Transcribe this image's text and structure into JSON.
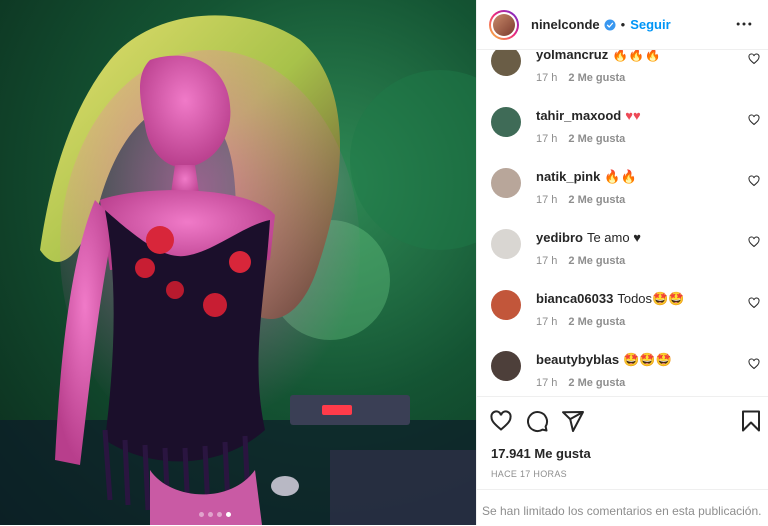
{
  "post": {
    "username": "ninelconde",
    "verified": true,
    "separator": "•",
    "follow_label": "Seguir",
    "likes_text": "17.941 Me gusta",
    "time_ago": "HACE 17 HORAS",
    "comments_limited": "Se han limitado los comentarios en esta publicación.",
    "carousel": {
      "count": 4,
      "active": 3
    }
  },
  "comments": [
    {
      "user": "yolmancruz",
      "text": "🔥🔥🔥",
      "time": "17 h",
      "likes": "2 Me gusta",
      "avatar_color": "#6a5d46"
    },
    {
      "user": "tahir_maxood",
      "text": "♥♥",
      "time": "17 h",
      "likes": "2 Me gusta",
      "avatar_color": "#3f6b57"
    },
    {
      "user": "natik_pink",
      "text": "🔥🔥",
      "time": "17 h",
      "likes": "2 Me gusta",
      "avatar_color": "#b8a69a"
    },
    {
      "user": "yedibro",
      "text": "Te amo ♥",
      "time": "17 h",
      "likes": "2 Me gusta",
      "avatar_color": "#d9d6d2"
    },
    {
      "user": "bianca06033",
      "text": "Todos🤩🤩",
      "time": "17 h",
      "likes": "2 Me gusta",
      "avatar_color": "#c2563a"
    },
    {
      "user": "beautybyblas",
      "text": "🤩🤩🤩",
      "time": "17 h",
      "likes": "2 Me gusta",
      "avatar_color": "#4d3f3a"
    }
  ],
  "icons": {
    "like": "heart-icon",
    "comment": "comment-icon",
    "share": "share-icon",
    "save": "bookmark-icon",
    "more": "more-options-icon"
  },
  "colors": {
    "accent": "#0095f6",
    "heart": "#ed4956",
    "verified": "#3897f0"
  }
}
